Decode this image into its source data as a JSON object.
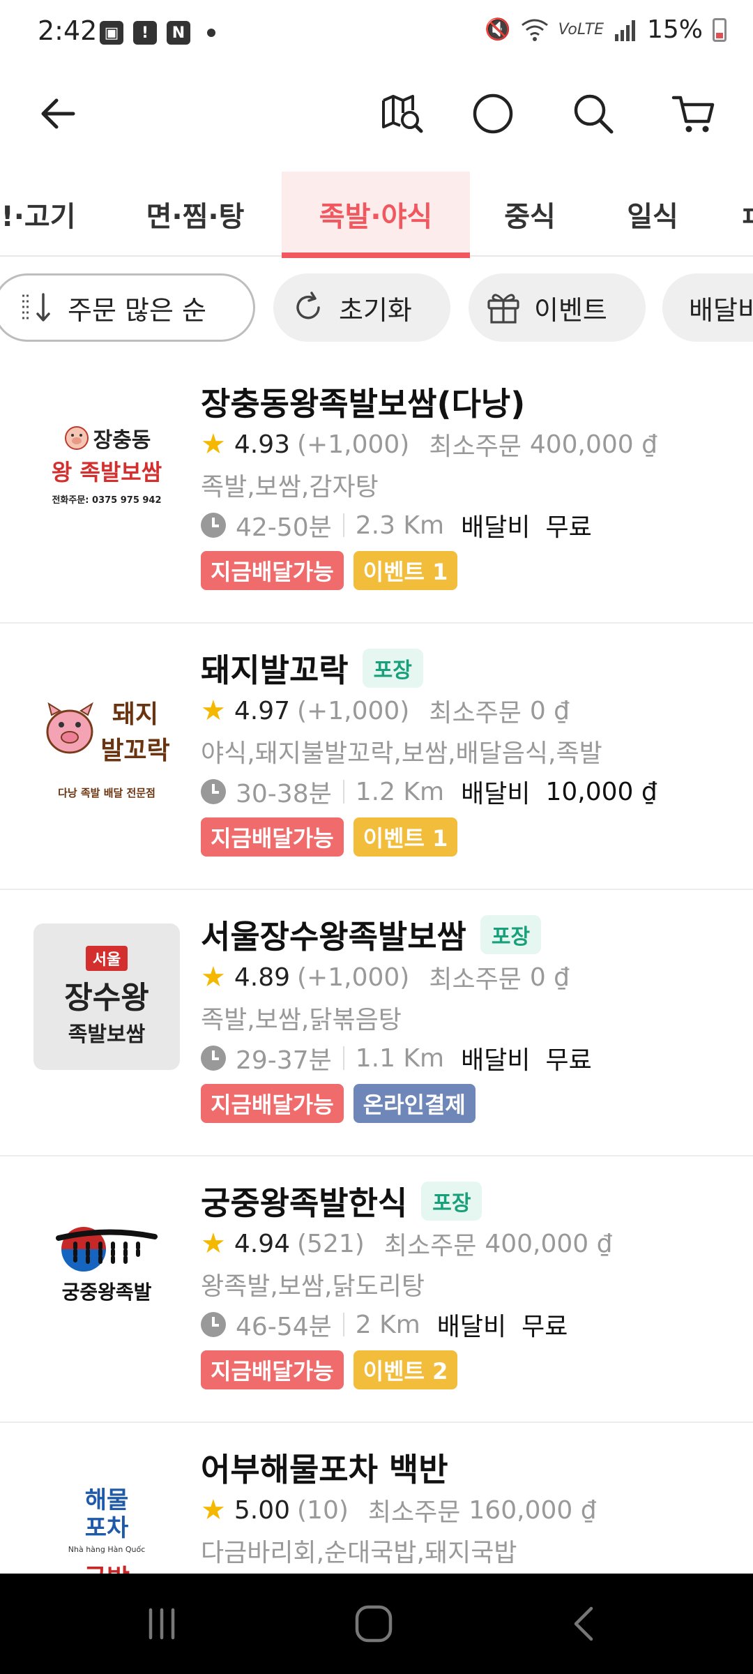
{
  "status_bar": {
    "time": "2:42",
    "battery": "15%",
    "icons": [
      "gallery-icon",
      "alert-icon",
      "n-icon",
      "mute-icon",
      "wifi-icon",
      "volte-icon",
      "signal-icon",
      "battery-icon"
    ]
  },
  "app_bar": {
    "icons": [
      "back-arrow-icon",
      "map-search-icon",
      "circle-icon",
      "search-icon",
      "cart-icon"
    ]
  },
  "tabs": [
    {
      "label": "!·고기"
    },
    {
      "label": "면·찜·탕"
    },
    {
      "label": "족발·야식"
    },
    {
      "label": "중식"
    },
    {
      "label": "일식"
    },
    {
      "label": "ㅍ"
    }
  ],
  "active_tab": "족발·야식",
  "chips": [
    {
      "label": "주문 많은 순",
      "icon": "sort-icon"
    },
    {
      "label": "초기화",
      "icon": "refresh-icon"
    },
    {
      "label": "이벤트",
      "icon": "gift-icon"
    },
    {
      "label": "배달비"
    }
  ],
  "stores": [
    {
      "name": "장충동왕족발보쌈(다낭)",
      "takeout": "",
      "rating": "4.93",
      "review_count": "(+1,000)",
      "min_order_label": "최소주문",
      "min_order": "400,000 ₫",
      "categories": "족발,보쌈,감자탕",
      "time": "42-50분",
      "distance": "2.3 Km",
      "fee_label": "배달비",
      "fee": "무료",
      "badges": [
        {
          "label": "지금배달가능",
          "color": "red"
        },
        {
          "label": "이벤트 1",
          "color": "yellow"
        }
      ],
      "logo": {
        "line1": "장충동",
        "line2": "왕 족발보쌈",
        "line3": "전화주문: 0375 975 942"
      }
    },
    {
      "name": "돼지발꼬락",
      "takeout": "포장",
      "rating": "4.97",
      "review_count": "(+1,000)",
      "min_order_label": "최소주문",
      "min_order": "0 ₫",
      "categories": "야식,돼지불발꼬락,보쌈,배달음식,족발",
      "time": "30-38분",
      "distance": "1.2 Km",
      "fee_label": "배달비",
      "fee": "10,000 ₫",
      "badges": [
        {
          "label": "지금배달가능",
          "color": "red"
        },
        {
          "label": "이벤트 1",
          "color": "yellow"
        }
      ],
      "logo": {
        "line1": "돼지",
        "line2": "발꼬락",
        "line3": "다낭 족발 배달 전문점"
      }
    },
    {
      "name": "서울장수왕족발보쌈",
      "takeout": "포장",
      "rating": "4.89",
      "review_count": "(+1,000)",
      "min_order_label": "최소주문",
      "min_order": "0 ₫",
      "categories": "족발,보쌈,닭볶음탕",
      "time": "29-37분",
      "distance": "1.1 Km",
      "fee_label": "배달비",
      "fee": "무료",
      "badges": [
        {
          "label": "지금배달가능",
          "color": "red"
        },
        {
          "label": "온라인결제",
          "color": "blue"
        }
      ],
      "logo": {
        "line1": "서울",
        "line2": "장수왕",
        "line3": "족발보쌈"
      }
    },
    {
      "name": "궁중왕족발한식",
      "takeout": "포장",
      "rating": "4.94",
      "review_count": "(521)",
      "min_order_label": "최소주문",
      "min_order": "400,000 ₫",
      "categories": "왕족발,보쌈,닭도리탕",
      "time": "46-54분",
      "distance": "2 Km",
      "fee_label": "배달비",
      "fee": "무료",
      "badges": [
        {
          "label": "지금배달가능",
          "color": "red"
        },
        {
          "label": "이벤트 2",
          "color": "yellow"
        }
      ],
      "logo": {
        "line1": "궁중왕족발"
      }
    },
    {
      "name": "어부해물포차 백반",
      "takeout": "",
      "rating": "5.00",
      "review_count": "(10)",
      "min_order_label": "최소주문",
      "min_order": "160,000 ₫",
      "categories": "다금바리회,순대국밥,돼지국밥",
      "logo": {
        "line1": "해물",
        "line2": "포차",
        "line3": "Nhà hàng Hàn Quốc",
        "line4": "국밥"
      }
    }
  ],
  "colors": {
    "accent": "#f0575e",
    "badge_red": "#f06b6b",
    "badge_yellow": "#f2bd3b",
    "badge_blue": "#6f87b8",
    "takeout_green": "#18a07a",
    "star": "#f5b800"
  }
}
